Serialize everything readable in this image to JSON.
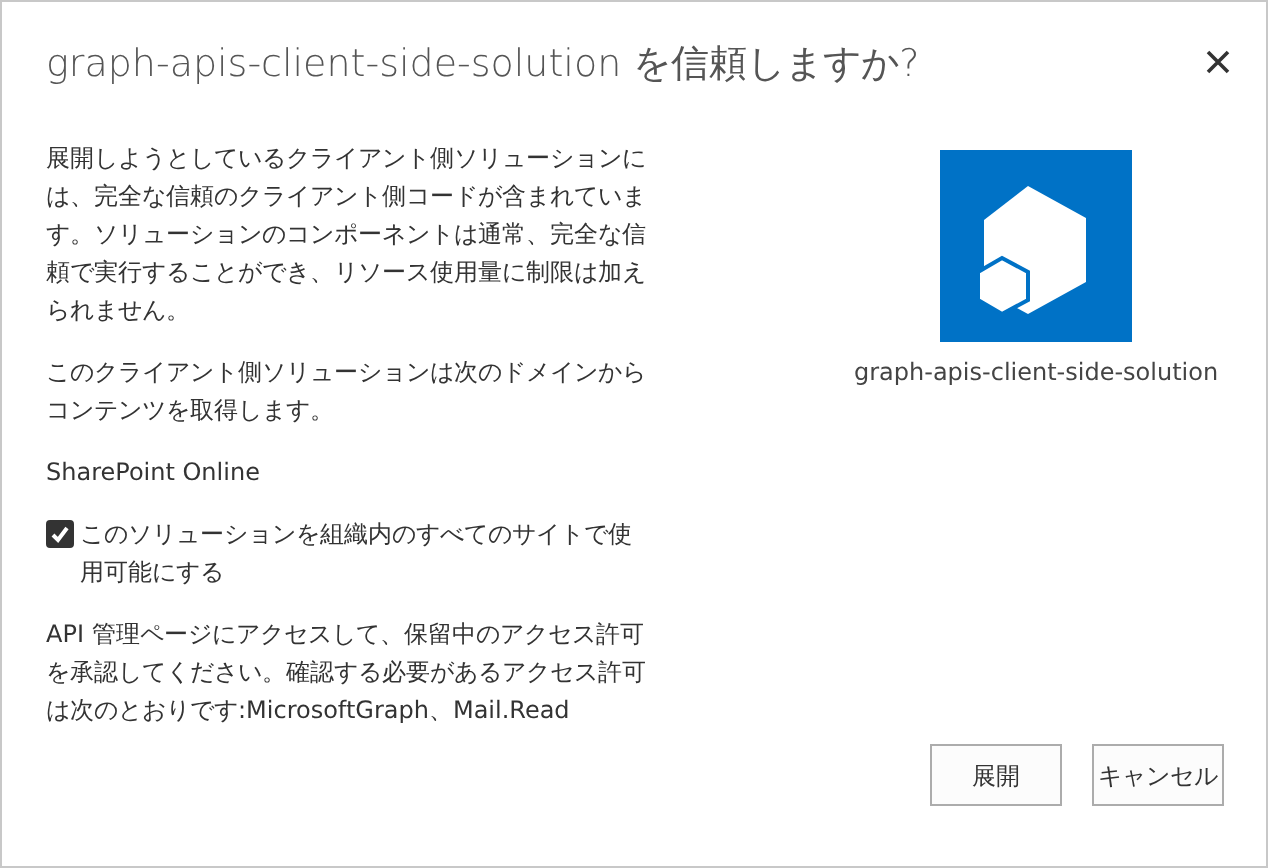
{
  "dialog": {
    "title": "graph-apis-client-side-solution を信頼しますか?"
  },
  "intro": "展開しようとしているクライアント側ソリューションには、完全な信頼のクライアント側コードが含まれています。ソリューションのコンポーネントは通常、完全な信頼で実行することができ、リソース使用量に制限は加えられません。",
  "domain_note": "このクライアント側ソリューションは次のドメインからコンテンツを取得します。",
  "domain": "SharePoint Online",
  "checkbox": {
    "label": "このソリューションを組織内のすべてのサイトで使用可能にする",
    "checked": true
  },
  "api_note": "API 管理ページにアクセスして、保留中のアクセス許可を承認してください。確認する必要があるアクセス許可は次のとおりです:MicrosoftGraph、Mail.Read",
  "app": {
    "name": "graph-apis-client-side-solution"
  },
  "buttons": [
    {
      "label": "展開"
    },
    {
      "label": "キャンセル"
    }
  ]
}
